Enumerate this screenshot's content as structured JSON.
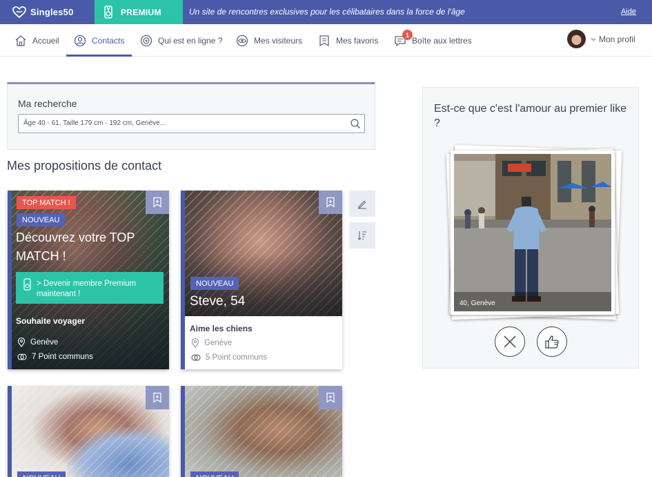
{
  "header": {
    "brand": "Singles50",
    "premium_label": "PREMIUM",
    "tagline": "Un site de rencontres exclusives pour les célibataires dans la force de l'âge",
    "help_link": "Aide",
    "brand_color": "#4a5aa8",
    "premium_color": "#2cc4a9"
  },
  "nav": {
    "items": [
      {
        "label": "Accueil",
        "icon": "home-icon"
      },
      {
        "label": "Contacts",
        "icon": "user-icon",
        "active": true
      },
      {
        "label": "Qui est en ligne ?",
        "icon": "online-icon"
      },
      {
        "label": "Mes visiteurs",
        "icon": "eye-icon"
      },
      {
        "label": "Mes favoris",
        "icon": "bookmark-icon"
      },
      {
        "label": "Boîte aux lettres",
        "icon": "mail-icon",
        "badge": "1"
      }
    ],
    "profile_label": "Mon profil"
  },
  "search": {
    "title": "Ma recherche",
    "value": "Âge 40 - 61, Taille 179 cm - 192 cm, Genève..."
  },
  "contacts": {
    "title": "Mes propositions de contact",
    "cards": [
      {
        "top_tag": "TOP MATCH !",
        "new_tag": "NOUVEAU",
        "headline": "Découvrez votre TOP MATCH !",
        "cta": "> Devenir membre Premium maintenant !",
        "wish": "Souhaite voyager",
        "location": "Genève",
        "common": "7 Point communs"
      },
      {
        "new_tag": "NOUVEAU",
        "name_age": "Steve, 54",
        "wish": "Aime les chiens",
        "location": "Genève",
        "common": "5 Point communs"
      },
      {
        "new_tag": "NOUVEAU"
      },
      {
        "new_tag": "NOUVEAU"
      }
    ]
  },
  "like": {
    "title": "Est-ce que c'est l'amour au premier like ?",
    "photo_caption": "40, Genève"
  }
}
